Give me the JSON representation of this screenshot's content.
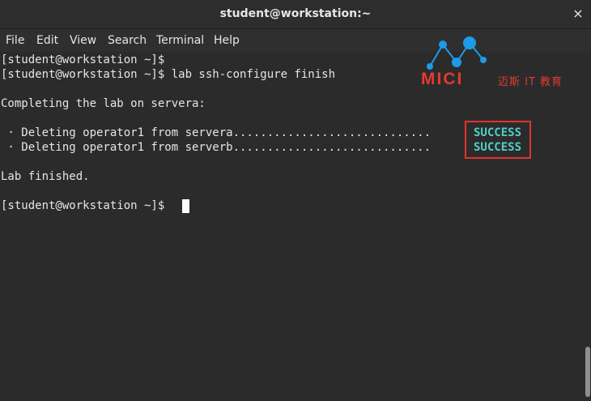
{
  "window": {
    "title": "student@workstation:~",
    "close_glyph": "×"
  },
  "menu": {
    "items": [
      "File",
      "Edit",
      "View",
      "Search",
      "Terminal",
      "Help"
    ]
  },
  "terminal": {
    "lines": [
      "[student@workstation ~]$",
      "[student@workstation ~]$ lab ssh-configure finish",
      "Completing the lab on servera:",
      " · Deleting operator1 from servera.............................",
      " · Deleting operator1 from serverb.............................",
      "Lab finished.",
      "[student@workstation ~]$ "
    ],
    "status": [
      "SUCCESS",
      "SUCCESS"
    ]
  },
  "watermark": {
    "brand": "MICI",
    "subtitle": "迈斯 IT 教育"
  },
  "colors": {
    "success": "#4dd0c8",
    "highlight": "#e0342b",
    "logo": "#e23b30",
    "logo_dots": "#1e9be8"
  }
}
